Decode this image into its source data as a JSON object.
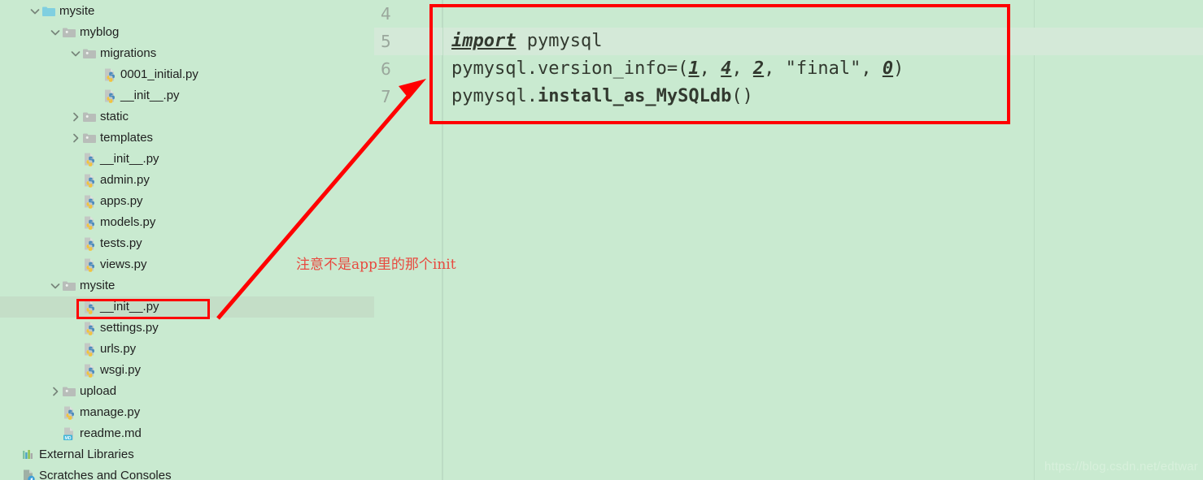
{
  "colors": {
    "background": "#c9ead0",
    "selection": "#c4dec7",
    "line_highlight": "#d4e9d8",
    "annotation_red": "#ff0000",
    "note_red": "#e8493f",
    "gutter_text": "#9aa79c",
    "code_text": "#32392f",
    "folder_blue": "#80cfe0",
    "folder_gray": "#b8bdb9",
    "watermark": "#d8f0dc"
  },
  "tree": {
    "name": "project-tree",
    "items": [
      {
        "label": "mysite",
        "depth": 1,
        "icon": "folder-module-icon",
        "twisty": "expanded",
        "selected": false
      },
      {
        "label": "myblog",
        "depth": 2,
        "icon": "folder-icon",
        "twisty": "expanded",
        "selected": false
      },
      {
        "label": "migrations",
        "depth": 3,
        "icon": "folder-icon",
        "twisty": "expanded",
        "selected": false
      },
      {
        "label": "0001_initial.py",
        "depth": 4,
        "icon": "python-file-icon",
        "twisty": "none",
        "selected": false
      },
      {
        "label": "__init__.py",
        "depth": 4,
        "icon": "python-file-icon",
        "twisty": "none",
        "selected": false
      },
      {
        "label": "static",
        "depth": 3,
        "icon": "folder-icon",
        "twisty": "collapsed",
        "selected": false
      },
      {
        "label": "templates",
        "depth": 3,
        "icon": "folder-icon",
        "twisty": "collapsed",
        "selected": false
      },
      {
        "label": "__init__.py",
        "depth": 3,
        "icon": "python-file-icon",
        "twisty": "none",
        "selected": false
      },
      {
        "label": "admin.py",
        "depth": 3,
        "icon": "python-file-icon",
        "twisty": "none",
        "selected": false
      },
      {
        "label": "apps.py",
        "depth": 3,
        "icon": "python-file-icon",
        "twisty": "none",
        "selected": false
      },
      {
        "label": "models.py",
        "depth": 3,
        "icon": "python-file-icon",
        "twisty": "none",
        "selected": false
      },
      {
        "label": "tests.py",
        "depth": 3,
        "icon": "python-file-icon",
        "twisty": "none",
        "selected": false
      },
      {
        "label": "views.py",
        "depth": 3,
        "icon": "python-file-icon",
        "twisty": "none",
        "selected": false
      },
      {
        "label": "mysite",
        "depth": 2,
        "icon": "folder-icon",
        "twisty": "expanded",
        "selected": false
      },
      {
        "label": "__init__.py",
        "depth": 3,
        "icon": "python-file-icon",
        "twisty": "none",
        "selected": true
      },
      {
        "label": "settings.py",
        "depth": 3,
        "icon": "python-file-icon",
        "twisty": "none",
        "selected": false
      },
      {
        "label": "urls.py",
        "depth": 3,
        "icon": "python-file-icon",
        "twisty": "none",
        "selected": false
      },
      {
        "label": "wsgi.py",
        "depth": 3,
        "icon": "python-file-icon",
        "twisty": "none",
        "selected": false
      },
      {
        "label": "upload",
        "depth": 2,
        "icon": "folder-icon",
        "twisty": "collapsed",
        "selected": false
      },
      {
        "label": "manage.py",
        "depth": 2,
        "icon": "python-file-icon",
        "twisty": "none",
        "selected": false
      },
      {
        "label": "readme.md",
        "depth": 2,
        "icon": "markdown-file-icon",
        "twisty": "none",
        "selected": false
      },
      {
        "label": "External Libraries",
        "depth": 0,
        "icon": "libraries-icon",
        "twisty": "none",
        "selected": false
      },
      {
        "label": "Scratches and Consoles",
        "depth": 0,
        "icon": "scratches-icon",
        "twisty": "none",
        "selected": false
      }
    ]
  },
  "editor": {
    "name": "code-editor",
    "line_numbers": [
      "4",
      "5",
      "6",
      "7"
    ],
    "current_line": "5",
    "lines": [
      {
        "n": "4",
        "segments": []
      },
      {
        "n": "5",
        "segments": [
          {
            "text": "import",
            "style": "kw"
          },
          {
            "text": " pymysql",
            "style": "plain"
          }
        ]
      },
      {
        "n": "6",
        "segments": [
          {
            "text": "pymysql.version_info=(",
            "style": "plain"
          },
          {
            "text": "1",
            "style": "num"
          },
          {
            "text": ", ",
            "style": "plain"
          },
          {
            "text": "4",
            "style": "num"
          },
          {
            "text": ", ",
            "style": "plain"
          },
          {
            "text": "2",
            "style": "num"
          },
          {
            "text": ", \"final\", ",
            "style": "plain"
          },
          {
            "text": "0",
            "style": "num"
          },
          {
            "text": ")",
            "style": "plain"
          }
        ]
      },
      {
        "n": "7",
        "segments": [
          {
            "text": "pymysql.",
            "style": "plain"
          },
          {
            "text": "install_as_MySQLdb",
            "style": "bold"
          },
          {
            "text": "()",
            "style": "plain"
          }
        ]
      }
    ]
  },
  "annotations": {
    "note_text": "注意不是app里的那个init",
    "code_box_label": "code-highlight-box",
    "file_box_label": "file-highlight-box",
    "arrow_label": "pointer-arrow"
  },
  "watermark": {
    "text": "https://blog.csdn.net/edtwar"
  }
}
